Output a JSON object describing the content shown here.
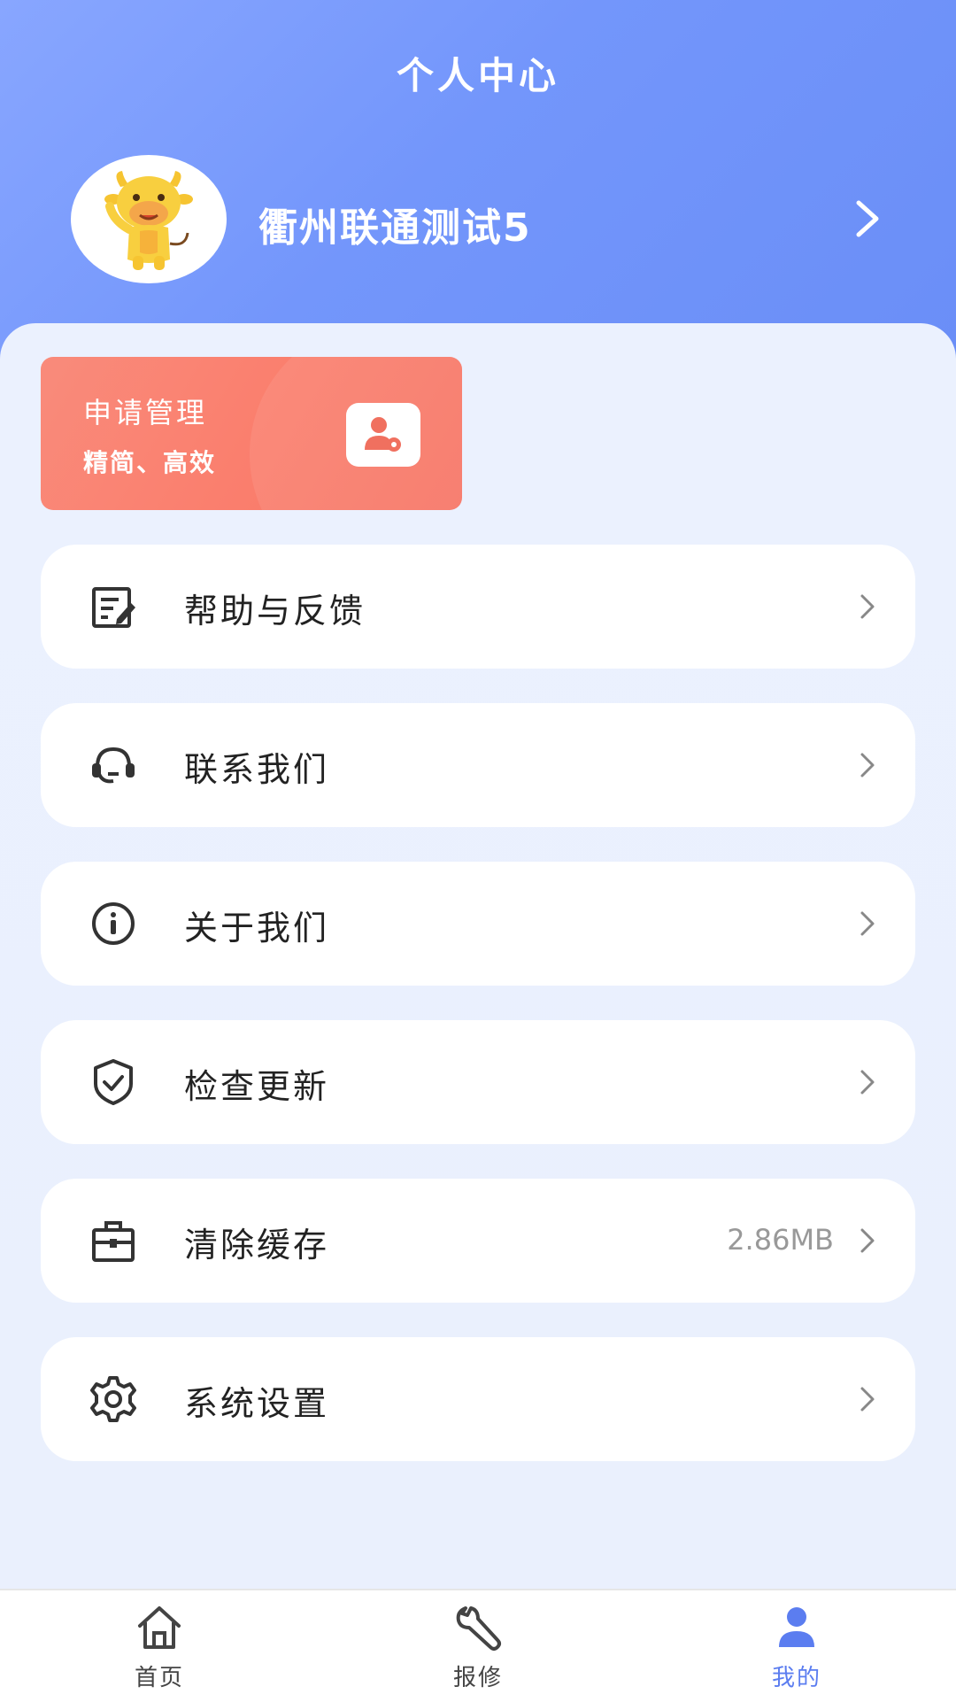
{
  "header": {
    "title": "个人中心",
    "username": "衢州联通测试5"
  },
  "apply_card": {
    "title": "申请管理",
    "subtitle": "精简、高效",
    "icon": "user-gear-icon"
  },
  "menu": [
    {
      "label": "帮助与反馈",
      "icon": "edit-note-icon",
      "value": ""
    },
    {
      "label": "联系我们",
      "icon": "headset-icon",
      "value": ""
    },
    {
      "label": "关于我们",
      "icon": "info-icon",
      "value": ""
    },
    {
      "label": "检查更新",
      "icon": "shield-check-icon",
      "value": ""
    },
    {
      "label": "清除缓存",
      "icon": "toolbox-icon",
      "value": "2.86MB"
    },
    {
      "label": "系统设置",
      "icon": "gear-icon",
      "value": ""
    }
  ],
  "tabbar": {
    "items": [
      {
        "label": "首页",
        "icon": "home-icon"
      },
      {
        "label": "报修",
        "icon": "wrench-icon"
      },
      {
        "label": "我的",
        "icon": "person-icon"
      }
    ],
    "active": "我的"
  },
  "colors": {
    "header": "#7396fb",
    "accent": "#5b7df0",
    "apply_card": "#fa7f6e",
    "background": "#eaf0fd"
  }
}
